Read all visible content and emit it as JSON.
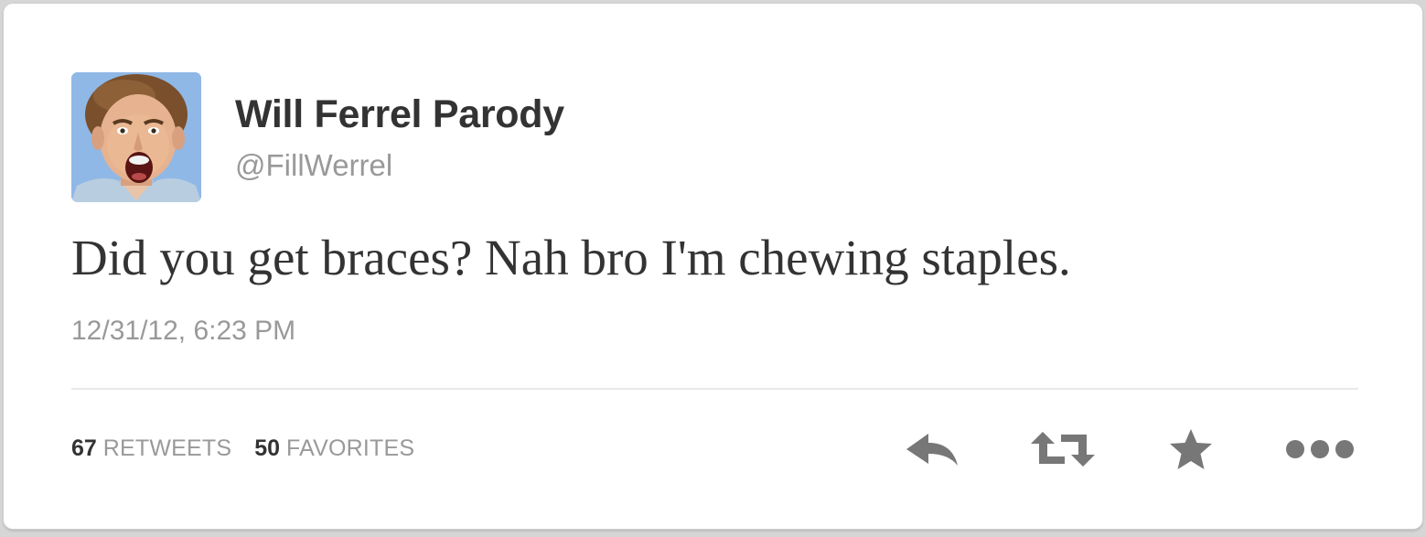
{
  "tweet": {
    "author": {
      "display_name": "Will Ferrel Parody",
      "handle": "@FillWerrel",
      "avatar_icon": "user-avatar-photo"
    },
    "text": "Did you get braces? Nah bro I'm chewing staples.",
    "timestamp": "12/31/12, 6:23 PM",
    "stats": {
      "retweets_count": "67",
      "retweets_label": "RETWEETS",
      "favorites_count": "50",
      "favorites_label": "FAVORITES"
    },
    "actions": [
      {
        "name": "reply",
        "icon": "reply-arrow-icon"
      },
      {
        "name": "retweet",
        "icon": "retweet-arrows-icon"
      },
      {
        "name": "favorite",
        "icon": "star-icon"
      },
      {
        "name": "more",
        "icon": "ellipsis-icon"
      }
    ]
  },
  "colors": {
    "background": "#d6d6d6",
    "card": "#ffffff",
    "text_primary": "#333333",
    "text_secondary": "#999999",
    "icon": "#777777",
    "divider": "#e8e8e8"
  }
}
